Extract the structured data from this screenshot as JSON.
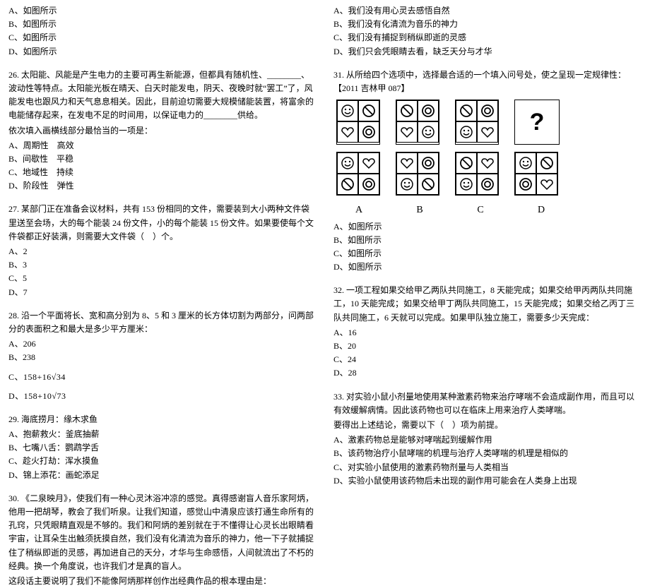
{
  "left": {
    "q25_opts": [
      "A、如图所示",
      "B、如图所示",
      "C、如图所示",
      "D、如图所示"
    ],
    "q26_stem": "26. 太阳能、风能是产生电力的主要可再生新能源，但都具有随机性、________、波动性等特点。太阳能光板在晴天、白天时能发电，阴天、夜晚时就“罢工”了，风能发电也跟风力和天气息息相关。因此，目前迫切需要大规模储能装置，将富余的电能储存起来，在发电不足的时间用，以保证电力的________供给。",
    "q26_prompt": "依次填入画横线部分最恰当的一项是：",
    "q26_opts": [
      "A、周期性　高效",
      "B、间歇性　平稳",
      "C、地域性　持续",
      "D、阶段性　弹性"
    ],
    "q27_stem": "27. 某部门正在准备会议材料，共有 153 份相同的文件，需要装到大小两种文件袋里送至会场，大的每个能装 24 份文件，小的每个能装 15 份文件。如果要使每个文件袋都正好装满，则需要大文件袋（　）个。",
    "q27_opts": [
      "A、2",
      "B、3",
      "C、5",
      "D、7"
    ],
    "q28_stem": "28. 沿一个平面将长、宽和高分别为 8、5 和 3 厘米的长方体切割为两部分，问两部分的表面积之和最大是多少平方厘米：",
    "q28_opts": [
      "A、206",
      "B、238"
    ],
    "q28_c": "C、158+16√34",
    "q28_d": "D、158+10√73",
    "q29_stem": "29. 海底捞月：缘木求鱼",
    "q29_opts": [
      "A、抱薪救火：釜底抽薪",
      "B、七嘴八舌：鹦鹉学舌",
      "C、趁火打劫：浑水摸鱼",
      "D、锦上添花：画蛇添足"
    ],
    "q30_stem": "30. 《二泉映月》，使我们有一种心灵沐浴冲凉的感觉。真得感谢盲人音乐家阿炳，他用一把胡琴，教会了我们听泉。让我们知道，感觉山中清泉应该打通生命所有的孔窍，只凭眼睛直观是不够的。我们和阿炳的差别就在于不懂得让心灵长出眼睛看宇宙，让耳朵生出触须抚摸自然，我们没有化清流为音乐的神力，他一下子就捕捉住了稍纵即逝的灵感，再加进自己的天分，才华与生命感悟，人间就流出了不朽的经典。换一个角度说，也许我们才是真的盲人。",
    "q30_tail": "这段话主要说明了我们不能像阿炳那样创作出经典作品的根本理由是："
  },
  "right": {
    "q30_opts": [
      "A、我们没有用心灵去感悟自然",
      "B、我们没有化清流为音乐的神力",
      "C、我们没有捕捉到稍纵即逝的灵感",
      "D、我们只会凭眼睛去看，缺乏天分与才华"
    ],
    "q31_stem": "31. 从所给四个选项中，选择最合适的一个填入问号处，使之呈现一定规律性：【2011 吉林甲 087】",
    "q31_opts": [
      "A、如图所示",
      "B、如图所示",
      "C、如图所示",
      "D、如图所示"
    ],
    "q32_stem": "32. 一项工程如果交给甲乙两队共同施工，8 天能完成；如果交给甲丙两队共同施工，10 天能完成；如果交给甲丁两队共同施工，15 天能完成；如果交给乙丙丁三队共同施工，6 天就可以完成。如果甲队独立施工，需要多少天完成：",
    "q32_opts": [
      "A、16",
      "B、20",
      "C、24",
      "D、28"
    ],
    "q33_stem": "33. 对实验小鼠小剂量地使用某种激素药物来治疗哮喘不会造成副作用，而且可以有效缓解病情。因此该药物也可以在临床上用来治疗人类哮喘。",
    "q33_tail": "要得出上述结论，需要以下（　）项为前提。",
    "q33_opts": [
      "A、激素药物总是能够对哮喘起到缓解作用",
      "B、该药物治疗小鼠哮喘的机理与治疗人类哮喘的机理是相似的",
      "C、对实验小鼠使用的激素药物剂量与人类相当",
      "D、实验小鼠使用该药物后未出现的副作用可能会在人类身上出现"
    ],
    "labels": [
      "A",
      "B",
      "C",
      "D"
    ]
  },
  "chart_data": {
    "type": "table",
    "description": "Figure-reasoning puzzle: two rows of 2x2 grids with symbols; top row is the sequence with a missing final grid (?), bottom row gives four answer options A–D.",
    "symbols": [
      "smile",
      "forbidden",
      "circle",
      "heart"
    ],
    "top_row": [
      [
        [
          "smile",
          "forbidden"
        ],
        [
          "heart",
          "circle"
        ]
      ],
      [
        [
          "forbidden",
          "circle"
        ],
        [
          "heart",
          "smile"
        ]
      ],
      [
        [
          "forbidden",
          "circle"
        ],
        [
          "smile",
          "heart"
        ]
      ],
      "?"
    ],
    "options": {
      "A": [
        [
          "smile",
          "heart"
        ],
        [
          "forbidden",
          "circle"
        ]
      ],
      "B": [
        [
          "heart",
          "circle"
        ],
        [
          "smile",
          "forbidden"
        ]
      ],
      "C": [
        [
          "forbidden",
          "heart"
        ],
        [
          "smile",
          "circle"
        ]
      ],
      "D": [
        [
          "smile",
          "forbidden"
        ],
        [
          "circle",
          "heart"
        ]
      ]
    }
  }
}
